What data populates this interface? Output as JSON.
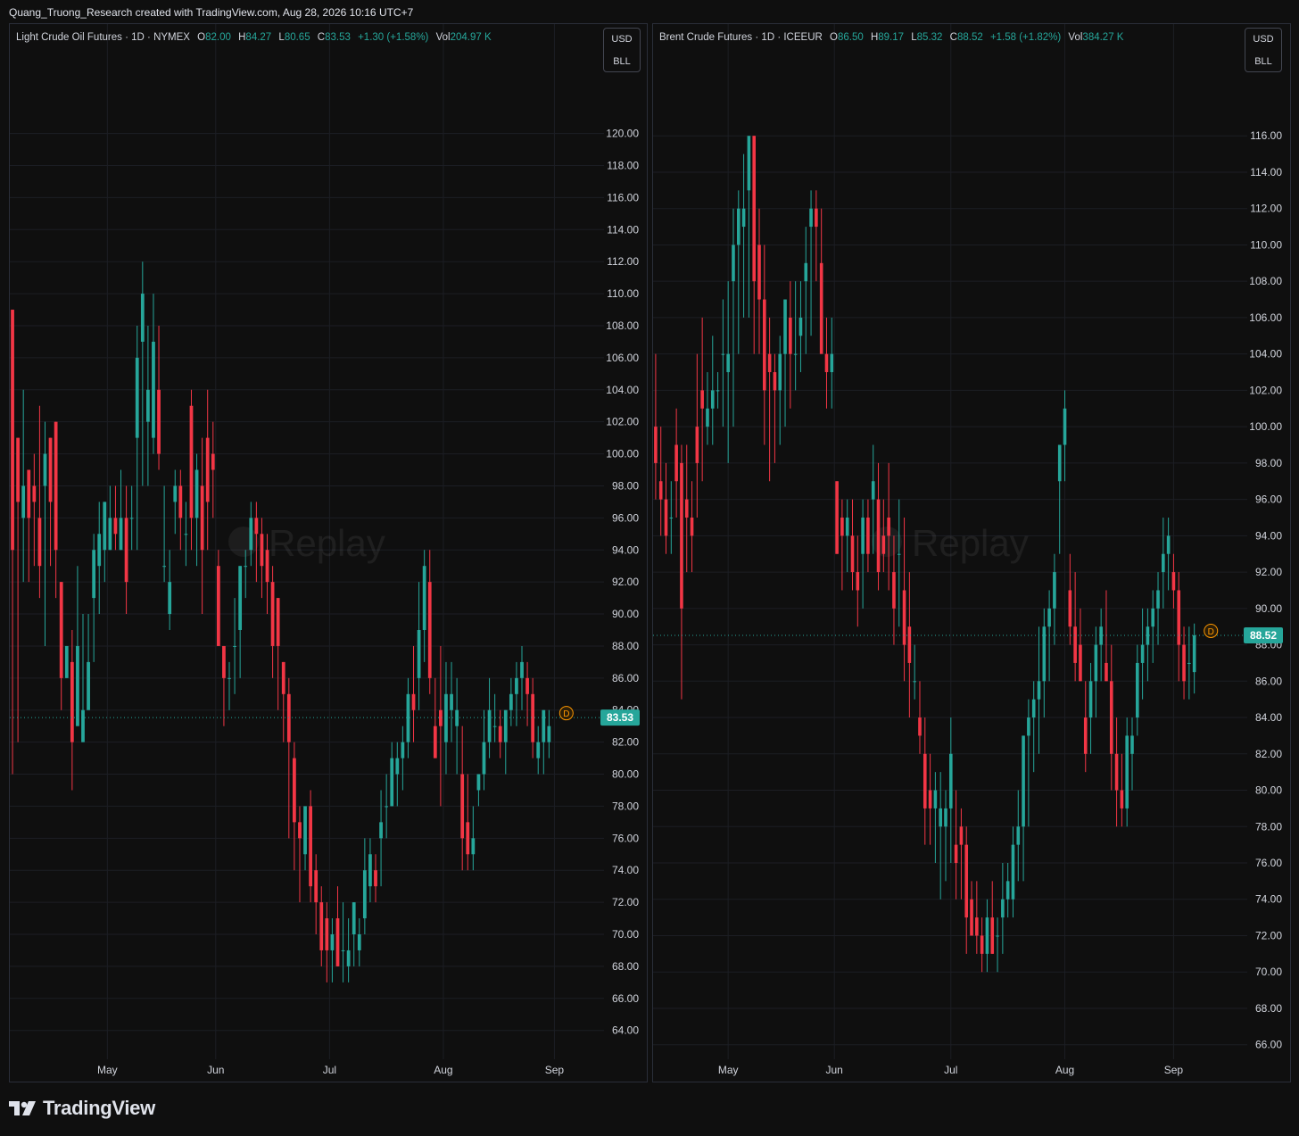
{
  "header": {
    "text": "Quang_Truong_Research created with TradingView.com, Aug 28, 2026 10:16 UTC+7"
  },
  "footer": {
    "brand": "TradingView"
  },
  "colors": {
    "background": "#0f0f0f",
    "grid": "#1c1e24",
    "up": "#26a69a",
    "down": "#f23645",
    "text": "#d1d4dc",
    "marker": "#ff9800"
  },
  "watermark": "Replay",
  "chart_data": [
    {
      "type": "candlestick",
      "title": "Light Crude Oil Futures",
      "interval": "1D",
      "exchange": "NYMEX",
      "ohlc_legend": {
        "O": "82.00",
        "H": "84.27",
        "L": "80.65",
        "C": "83.53",
        "change": "+1.30 (+1.58%)",
        "Vol": "204.97 K"
      },
      "currency": "USD",
      "unit": "BLL",
      "last_price": "83.53",
      "last_value": 83.53,
      "ylim": [
        62.2,
        123.6
      ],
      "y_ticks": [
        "120.00",
        "118.00",
        "116.00",
        "114.00",
        "112.00",
        "110.00",
        "108.00",
        "106.00",
        "104.00",
        "102.00",
        "100.00",
        "98.00",
        "96.00",
        "94.00",
        "92.00",
        "90.00",
        "88.00",
        "86.00",
        "84.00",
        "82.00",
        "80.00",
        "78.00",
        "76.00",
        "74.00",
        "72.00",
        "70.00",
        "68.00",
        "66.00",
        "64.00"
      ],
      "x_ticks": [
        "May",
        "Jun",
        "Jul",
        "Aug",
        "Sep"
      ],
      "x_tick_index": [
        17.5,
        37.5,
        58.5,
        79.5,
        100
      ],
      "marker_label": "D",
      "candles": [
        [
          109,
          109,
          80,
          94
        ],
        [
          101,
          101,
          82,
          97
        ],
        [
          96,
          104,
          92,
          98
        ],
        [
          99,
          99,
          92,
          96
        ],
        [
          98,
          100,
          93,
          97
        ],
        [
          96,
          103,
          91,
          93
        ],
        [
          98,
          102,
          88,
          100
        ],
        [
          101,
          101,
          93,
          97
        ],
        [
          102,
          102,
          91,
          94
        ],
        [
          92,
          92,
          84,
          86
        ],
        [
          86,
          88,
          86,
          88
        ],
        [
          87,
          89,
          79,
          82
        ],
        [
          83,
          93,
          84,
          88
        ],
        [
          82,
          90,
          82,
          84
        ],
        [
          84,
          90,
          85,
          87
        ],
        [
          91,
          95,
          87,
          94
        ],
        [
          93,
          97,
          90,
          95
        ],
        [
          94,
          97,
          92,
          97
        ],
        [
          94,
          98,
          94,
          96
        ],
        [
          96,
          98,
          94,
          95
        ],
        [
          94,
          99,
          94,
          96
        ],
        [
          96,
          98,
          90,
          92
        ],
        [
          96,
          98,
          94,
          96
        ],
        [
          101,
          108,
          94,
          106
        ],
        [
          107,
          112,
          98,
          110
        ],
        [
          102,
          108,
          98,
          104
        ],
        [
          101,
          110,
          100,
          107
        ],
        [
          104,
          108,
          99,
          100
        ],
        [
          93,
          98,
          92,
          93
        ],
        [
          90,
          94,
          89,
          92
        ],
        [
          97,
          99,
          95,
          98
        ],
        [
          98,
          99,
          94,
          96
        ],
        [
          95,
          97,
          93,
          95
        ],
        [
          103,
          104,
          94,
          96
        ],
        [
          96,
          100,
          93,
          99
        ],
        [
          98,
          101,
          90,
          94
        ],
        [
          101,
          104,
          94,
          97
        ],
        [
          100,
          102,
          96,
          99
        ],
        [
          93,
          94,
          88,
          88
        ],
        [
          88,
          88,
          83,
          86
        ],
        [
          86,
          87,
          84,
          86
        ],
        [
          88,
          91,
          85,
          88
        ],
        [
          89,
          93,
          86,
          93
        ],
        [
          93,
          94,
          91,
          93
        ],
        [
          94,
          97,
          93,
          96
        ],
        [
          96,
          97,
          92,
          95
        ],
        [
          95,
          96,
          91,
          93
        ],
        [
          94,
          95,
          90,
          92
        ],
        [
          92,
          93,
          86,
          88
        ],
        [
          91,
          91,
          84,
          88
        ],
        [
          87,
          87,
          82,
          85
        ],
        [
          85,
          86,
          76,
          82
        ],
        [
          81,
          82,
          74,
          77
        ],
        [
          77,
          78,
          72,
          76
        ],
        [
          75,
          78,
          74,
          78
        ],
        [
          78,
          79,
          72,
          73
        ],
        [
          74,
          75,
          70,
          72
        ],
        [
          72,
          73,
          68,
          69
        ],
        [
          71,
          72,
          67,
          69
        ],
        [
          69,
          71,
          67,
          70
        ],
        [
          71,
          73,
          68,
          68
        ],
        [
          69,
          72,
          67,
          69
        ],
        [
          68,
          71,
          67,
          69
        ],
        [
          70,
          72,
          68,
          72
        ],
        [
          69,
          71,
          68,
          70
        ],
        [
          71,
          76,
          70,
          74
        ],
        [
          73,
          76,
          72,
          75
        ],
        [
          74,
          75,
          72,
          73
        ],
        [
          76,
          79,
          73,
          77
        ],
        [
          78,
          80,
          76,
          78
        ],
        [
          78,
          82,
          78,
          81
        ],
        [
          80,
          82,
          78,
          81
        ],
        [
          81,
          83,
          79,
          82
        ],
        [
          82,
          86,
          81,
          85
        ],
        [
          85,
          88,
          82,
          84
        ],
        [
          86,
          92,
          84,
          89
        ],
        [
          89,
          94,
          87,
          93
        ],
        [
          92,
          94,
          85,
          86
        ],
        [
          83,
          86,
          81,
          81
        ],
        [
          84,
          88,
          78,
          83
        ],
        [
          82,
          87,
          80,
          85
        ],
        [
          84,
          87,
          82,
          85
        ],
        [
          83,
          86,
          80,
          84
        ],
        [
          80,
          83,
          74,
          76
        ],
        [
          77,
          80,
          74,
          75
        ],
        [
          75,
          78,
          74,
          76
        ],
        [
          79,
          80,
          78,
          80
        ],
        [
          80,
          84,
          79,
          82
        ],
        [
          82,
          86,
          81,
          84
        ],
        [
          83,
          85,
          82,
          83
        ],
        [
          83,
          84,
          81,
          82
        ],
        [
          82,
          84,
          80,
          84
        ],
        [
          84,
          86,
          83,
          85
        ],
        [
          85,
          87,
          83,
          86
        ],
        [
          86,
          88,
          84,
          87
        ],
        [
          86,
          87,
          83,
          85
        ],
        [
          85,
          86,
          81,
          82
        ],
        [
          81,
          83,
          80,
          82
        ],
        [
          82,
          84,
          80,
          84
        ],
        [
          82,
          84,
          81,
          83
        ]
      ]
    },
    {
      "type": "candlestick",
      "title": "Brent Crude Futures",
      "interval": "1D",
      "exchange": "ICEEUR",
      "ohlc_legend": {
        "O": "86.50",
        "H": "89.17",
        "L": "85.32",
        "C": "88.52",
        "change": "+1.58 (+1.82%)",
        "Vol": "384.27 K"
      },
      "currency": "USD",
      "unit": "BLL",
      "last_price": "88.52",
      "last_value": 88.52,
      "ylim": [
        65.2,
        119.3
      ],
      "y_ticks": [
        "116.00",
        "114.00",
        "112.00",
        "110.00",
        "108.00",
        "106.00",
        "104.00",
        "102.00",
        "100.00",
        "98.00",
        "96.00",
        "94.00",
        "92.00",
        "90.00",
        "88.00",
        "86.00",
        "84.00",
        "82.00",
        "80.00",
        "78.00",
        "76.00",
        "74.00",
        "72.00",
        "70.00",
        "68.00",
        "66.00"
      ],
      "x_ticks": [
        "May",
        "Jun",
        "Jul",
        "Aug",
        "Sep"
      ],
      "x_tick_index": [
        14,
        34.5,
        57,
        79,
        100
      ],
      "marker_label": "D",
      "candles": [
        [
          100,
          104,
          96,
          98
        ],
        [
          97,
          100,
          94,
          96
        ],
        [
          96,
          98,
          93,
          94
        ],
        [
          95,
          97,
          93,
          95
        ],
        [
          99,
          101,
          95,
          97
        ],
        [
          98,
          99,
          85,
          90
        ],
        [
          96,
          99,
          92,
          95
        ],
        [
          95,
          97,
          92,
          94
        ],
        [
          100,
          104,
          95,
          98
        ],
        [
          102,
          106,
          97,
          101
        ],
        [
          100,
          103,
          99,
          101
        ],
        [
          101,
          105,
          99,
          102
        ],
        [
          102,
          103,
          101,
          102
        ],
        [
          104,
          107,
          100,
          104
        ],
        [
          103,
          108,
          98,
          104
        ],
        [
          108,
          112,
          100,
          110
        ],
        [
          110,
          113,
          104,
          112
        ],
        [
          111,
          115,
          106,
          112
        ],
        [
          113,
          115,
          106,
          116
        ],
        [
          116,
          116,
          104,
          108
        ],
        [
          110,
          112,
          104,
          107
        ],
        [
          107,
          110,
          99,
          102
        ],
        [
          104,
          106,
          97,
          103
        ],
        [
          103,
          104,
          98,
          102
        ],
        [
          102,
          105,
          99,
          104
        ],
        [
          104,
          106,
          100,
          107
        ],
        [
          106,
          108,
          101,
          104
        ],
        [
          104,
          108,
          102,
          104
        ],
        [
          105,
          108,
          103,
          106
        ],
        [
          108,
          111,
          104,
          109
        ],
        [
          111,
          113,
          105,
          112
        ],
        [
          112,
          113,
          108,
          111
        ],
        [
          109,
          112,
          106,
          104
        ],
        [
          104,
          106,
          101,
          103
        ],
        [
          103,
          106,
          101,
          104
        ],
        [
          97,
          97,
          93,
          93
        ],
        [
          95,
          96,
          91,
          94
        ],
        [
          94,
          96,
          92,
          95
        ],
        [
          94,
          96,
          91,
          92
        ],
        [
          92,
          94,
          89,
          91
        ],
        [
          93,
          96,
          90,
          95
        ],
        [
          95,
          96,
          92,
          93
        ],
        [
          96,
          99,
          93,
          97
        ],
        [
          96,
          98,
          91,
          92
        ],
        [
          94,
          96,
          92,
          93
        ],
        [
          95,
          98,
          91,
          94
        ],
        [
          92,
          94,
          88,
          90
        ],
        [
          93,
          96,
          89,
          93
        ],
        [
          91,
          95,
          86,
          88
        ],
        [
          89,
          92,
          84,
          87
        ],
        [
          86,
          88,
          85,
          86
        ],
        [
          84,
          86,
          82,
          83
        ],
        [
          82,
          84,
          77,
          79
        ],
        [
          80,
          82,
          77,
          79
        ],
        [
          79,
          81,
          76,
          80
        ],
        [
          78,
          81,
          74,
          79
        ],
        [
          78,
          80,
          75,
          79
        ],
        [
          79,
          84,
          76,
          82
        ],
        [
          77,
          80,
          74,
          76
        ],
        [
          78,
          79,
          74,
          77
        ],
        [
          77,
          78,
          71,
          73
        ],
        [
          74,
          75,
          72,
          72
        ],
        [
          73,
          75,
          71,
          72
        ],
        [
          72,
          73,
          70,
          71
        ],
        [
          71,
          74,
          70,
          73
        ],
        [
          73,
          75,
          71,
          71
        ],
        [
          72,
          73,
          70,
          72
        ],
        [
          73,
          76,
          71,
          74
        ],
        [
          74,
          76,
          73,
          75
        ],
        [
          74,
          78,
          73,
          77
        ],
        [
          77,
          80,
          75,
          78
        ],
        [
          78,
          83,
          75,
          83
        ],
        [
          83,
          85,
          78,
          84
        ],
        [
          84,
          86,
          81,
          85
        ],
        [
          85,
          89,
          82,
          86
        ],
        [
          86,
          90,
          84,
          89
        ],
        [
          89,
          91,
          86,
          90
        ],
        [
          90,
          93,
          88,
          92
        ],
        [
          97,
          98,
          93,
          99
        ],
        [
          99,
          102,
          97,
          101
        ],
        [
          91,
          93,
          88,
          89
        ],
        [
          89,
          92,
          86,
          87
        ],
        [
          88,
          90,
          86,
          86
        ],
        [
          84,
          86,
          81,
          82
        ],
        [
          84,
          87,
          82,
          86
        ],
        [
          86,
          89,
          84,
          88
        ],
        [
          88,
          90,
          86,
          89
        ],
        [
          87,
          91,
          86,
          86
        ],
        [
          86,
          88,
          80,
          82
        ],
        [
          82,
          84,
          78,
          80
        ],
        [
          80,
          82,
          78,
          79
        ],
        [
          79,
          84,
          78,
          83
        ],
        [
          82,
          84,
          80,
          83
        ],
        [
          84,
          88,
          83,
          87
        ],
        [
          87,
          90,
          85,
          88
        ],
        [
          88,
          90,
          86,
          89
        ],
        [
          89,
          91,
          87,
          90
        ],
        [
          90,
          92,
          88,
          91
        ],
        [
          92,
          95,
          90,
          93
        ],
        [
          93,
          95,
          91,
          94
        ],
        [
          92,
          93,
          90,
          91
        ],
        [
          91,
          92,
          86,
          88
        ],
        [
          88,
          89,
          85,
          86
        ],
        [
          87,
          89,
          85,
          87
        ],
        [
          86.5,
          89.17,
          85.32,
          88.52
        ]
      ]
    }
  ]
}
